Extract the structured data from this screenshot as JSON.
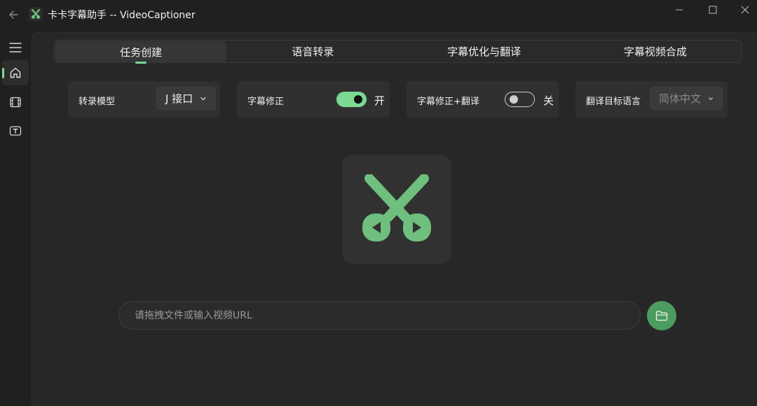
{
  "app": {
    "title": "卡卡字幕助手 -- VideoCaptioner",
    "back_icon": "arrow-left-icon",
    "logo_icon": "scissors-icon"
  },
  "window_controls": [
    "minimize-icon",
    "maximize-icon",
    "close-icon"
  ],
  "sidebar": {
    "items": [
      {
        "icon": "home-icon",
        "active": true
      },
      {
        "icon": "film-icon",
        "active": false
      },
      {
        "icon": "text-box-icon",
        "active": false
      }
    ]
  },
  "tabs": [
    {
      "label": "任务创建",
      "active": true
    },
    {
      "label": "语音转录",
      "active": false
    },
    {
      "label": "字幕优化与翻译",
      "active": false
    },
    {
      "label": "字幕视频合成",
      "active": false
    }
  ],
  "options": {
    "model": {
      "label": "转录模型",
      "value": "J 接口"
    },
    "correction": {
      "label": "字幕修正",
      "on": true,
      "state_text": "开"
    },
    "correction_translate": {
      "label": "字幕修正+翻译",
      "on": false,
      "state_text": "关"
    },
    "target_language": {
      "label": "翻译目标语言",
      "value": "简体中文",
      "disabled": true
    }
  },
  "input": {
    "placeholder": "请拖拽文件或输入视频URL",
    "value": ""
  },
  "folder_button": {
    "icon": "folder-icon"
  },
  "colors": {
    "accent": "#7cd992",
    "logo_green": "#6fbf7e",
    "button_green": "#4c9c61",
    "background": "#202020",
    "panel": "#272727"
  }
}
